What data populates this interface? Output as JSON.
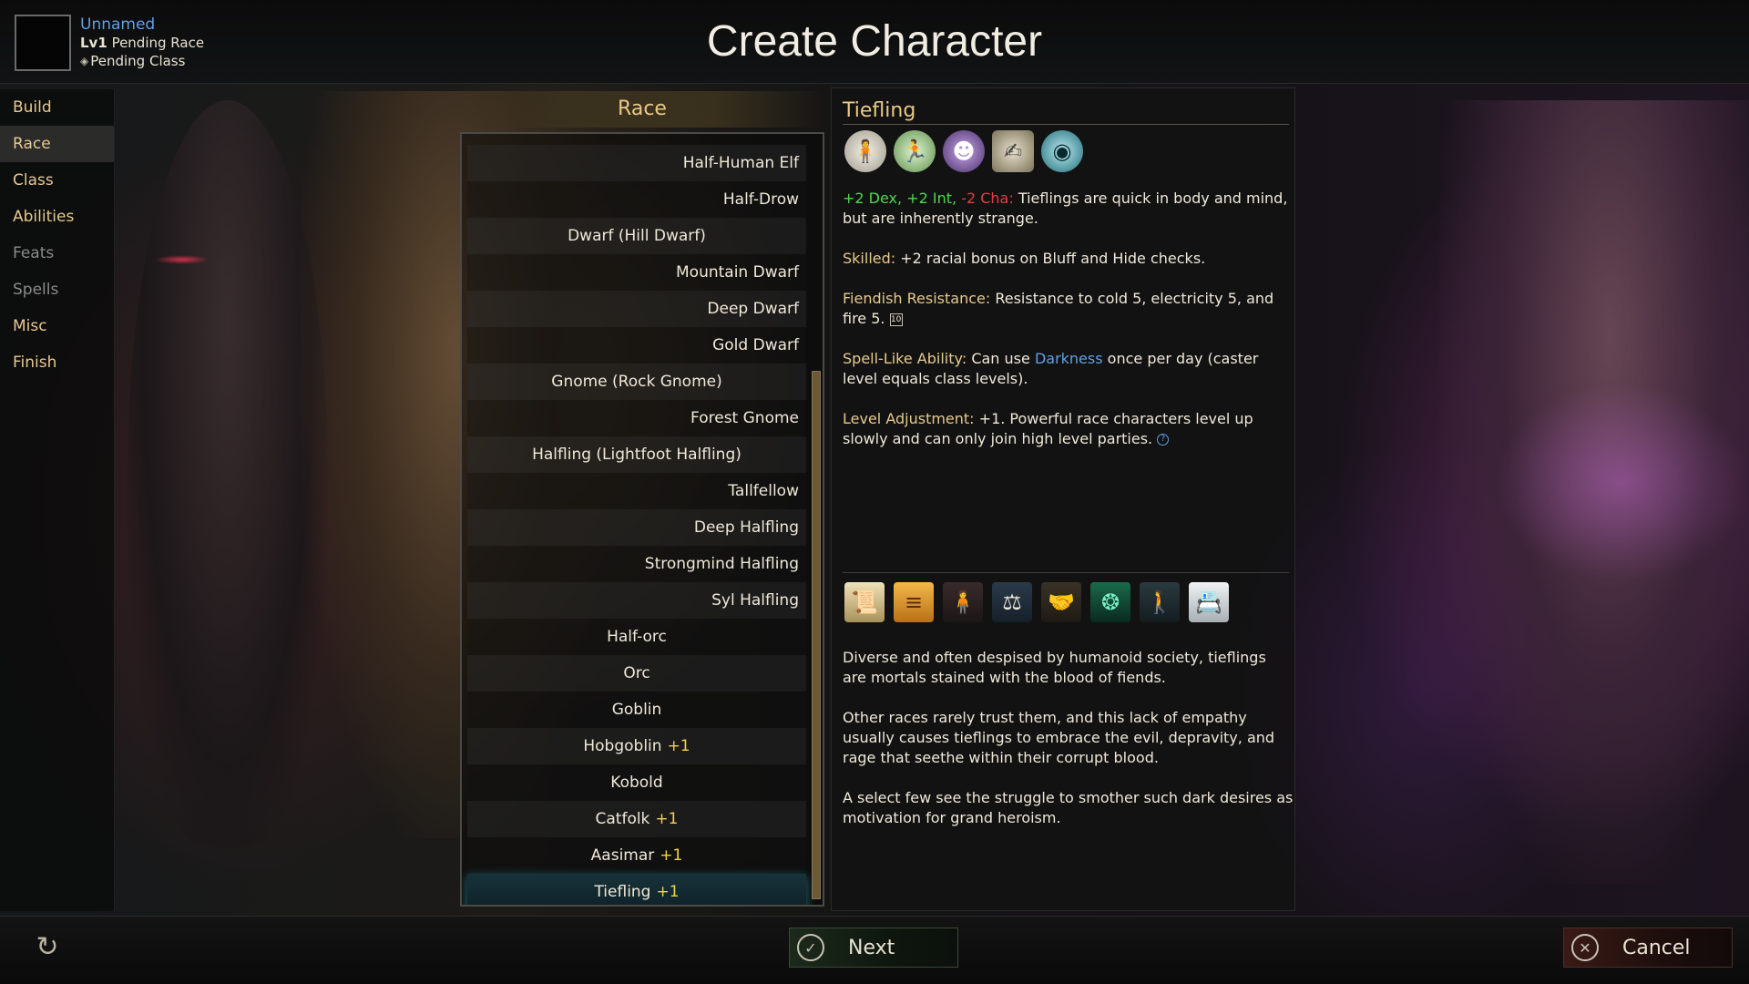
{
  "header": {
    "title": "Create Character",
    "character": {
      "name": "Unnamed",
      "level_prefix": "Lv1",
      "race": "Pending Race",
      "class": "Pending Class"
    }
  },
  "sidebar": {
    "items": [
      {
        "label": "Build",
        "state": "normal"
      },
      {
        "label": "Race",
        "state": "active"
      },
      {
        "label": "Class",
        "state": "normal"
      },
      {
        "label": "Abilities",
        "state": "normal"
      },
      {
        "label": "Feats",
        "state": "disabled"
      },
      {
        "label": "Spells",
        "state": "disabled"
      },
      {
        "label": "Misc",
        "state": "normal"
      },
      {
        "label": "Finish",
        "state": "normal"
      }
    ]
  },
  "race_panel": {
    "header": "Race",
    "races": [
      {
        "name": "Half-Human Elf",
        "adj": "",
        "align": "right"
      },
      {
        "name": "Half-Drow",
        "adj": "",
        "align": "right"
      },
      {
        "name": "Dwarf (Hill Dwarf)",
        "adj": "",
        "align": "center"
      },
      {
        "name": "Mountain Dwarf",
        "adj": "",
        "align": "right"
      },
      {
        "name": "Deep Dwarf",
        "adj": "",
        "align": "right"
      },
      {
        "name": "Gold Dwarf",
        "adj": "",
        "align": "right"
      },
      {
        "name": "Gnome (Rock Gnome)",
        "adj": "",
        "align": "center"
      },
      {
        "name": "Forest Gnome",
        "adj": "",
        "align": "right"
      },
      {
        "name": "Halfling (Lightfoot Halfling)",
        "adj": "",
        "align": "center"
      },
      {
        "name": "Tallfellow",
        "adj": "",
        "align": "right"
      },
      {
        "name": "Deep Halfling",
        "adj": "",
        "align": "right"
      },
      {
        "name": "Strongmind Halfling",
        "adj": "",
        "align": "right"
      },
      {
        "name": "Syl Halfling",
        "adj": "",
        "align": "right"
      },
      {
        "name": "Half-orc",
        "adj": "",
        "align": "center"
      },
      {
        "name": "Orc",
        "adj": "",
        "align": "center"
      },
      {
        "name": "Goblin",
        "adj": "",
        "align": "center"
      },
      {
        "name": "Hobgoblin",
        "adj": "+1",
        "align": "center"
      },
      {
        "name": "Kobold",
        "adj": "",
        "align": "center"
      },
      {
        "name": "Catfolk",
        "adj": "+1",
        "align": "center"
      },
      {
        "name": "Aasimar",
        "adj": "+1",
        "align": "center"
      },
      {
        "name": "Tiefling",
        "adj": "+1",
        "align": "center",
        "selected": true
      }
    ]
  },
  "detail": {
    "title": "Tiefling",
    "trait_icons": [
      "humanoid-icon",
      "running-figure-icon",
      "hooded-face-icon",
      "scroll-hand-icon",
      "eye-icon"
    ],
    "ability_mods": {
      "pos": "+2 Dex, +2 Int,",
      "neg": "-2 Cha:"
    },
    "ability_text": "Tieflings are quick in body and mind, but are inherently strange.",
    "skilled_label": "Skilled:",
    "skilled_text": "+2 racial bonus on Bluff and Hide checks.",
    "fiendish_label": "Fiendish Resistance:",
    "fiendish_text": "Resistance to cold 5, electricity 5, and fire 5.",
    "fiendish_ref": "10",
    "spell_label": "Spell-Like Ability:",
    "spell_text_pre": "Can use",
    "spell_link": "Darkness",
    "spell_text_post": "once per day (caster level equals class levels).",
    "level_label": "Level Adjustment:",
    "level_text": "+1. Powerful race characters level up slowly and can only join high level parties.",
    "feat_icons": [
      "scroll-icon",
      "orange-scroll-icon",
      "figure-icon",
      "crowd-scales-icon",
      "handshake-icon",
      "demon-icon",
      "walking-figure-icon",
      "id-card-icon"
    ],
    "lore": [
      "Diverse and often despised by humanoid society, tieflings are  mortals stained with the blood of fiends.",
      "Other races rarely trust them, and this lack of empathy usually causes tieflings to embrace the evil, depravity, and rage that seethe within their corrupt blood.",
      "A select few see the struggle to smother such dark desires as motivation for grand heroism."
    ]
  },
  "footer": {
    "next_label": "Next",
    "cancel_label": "Cancel"
  }
}
